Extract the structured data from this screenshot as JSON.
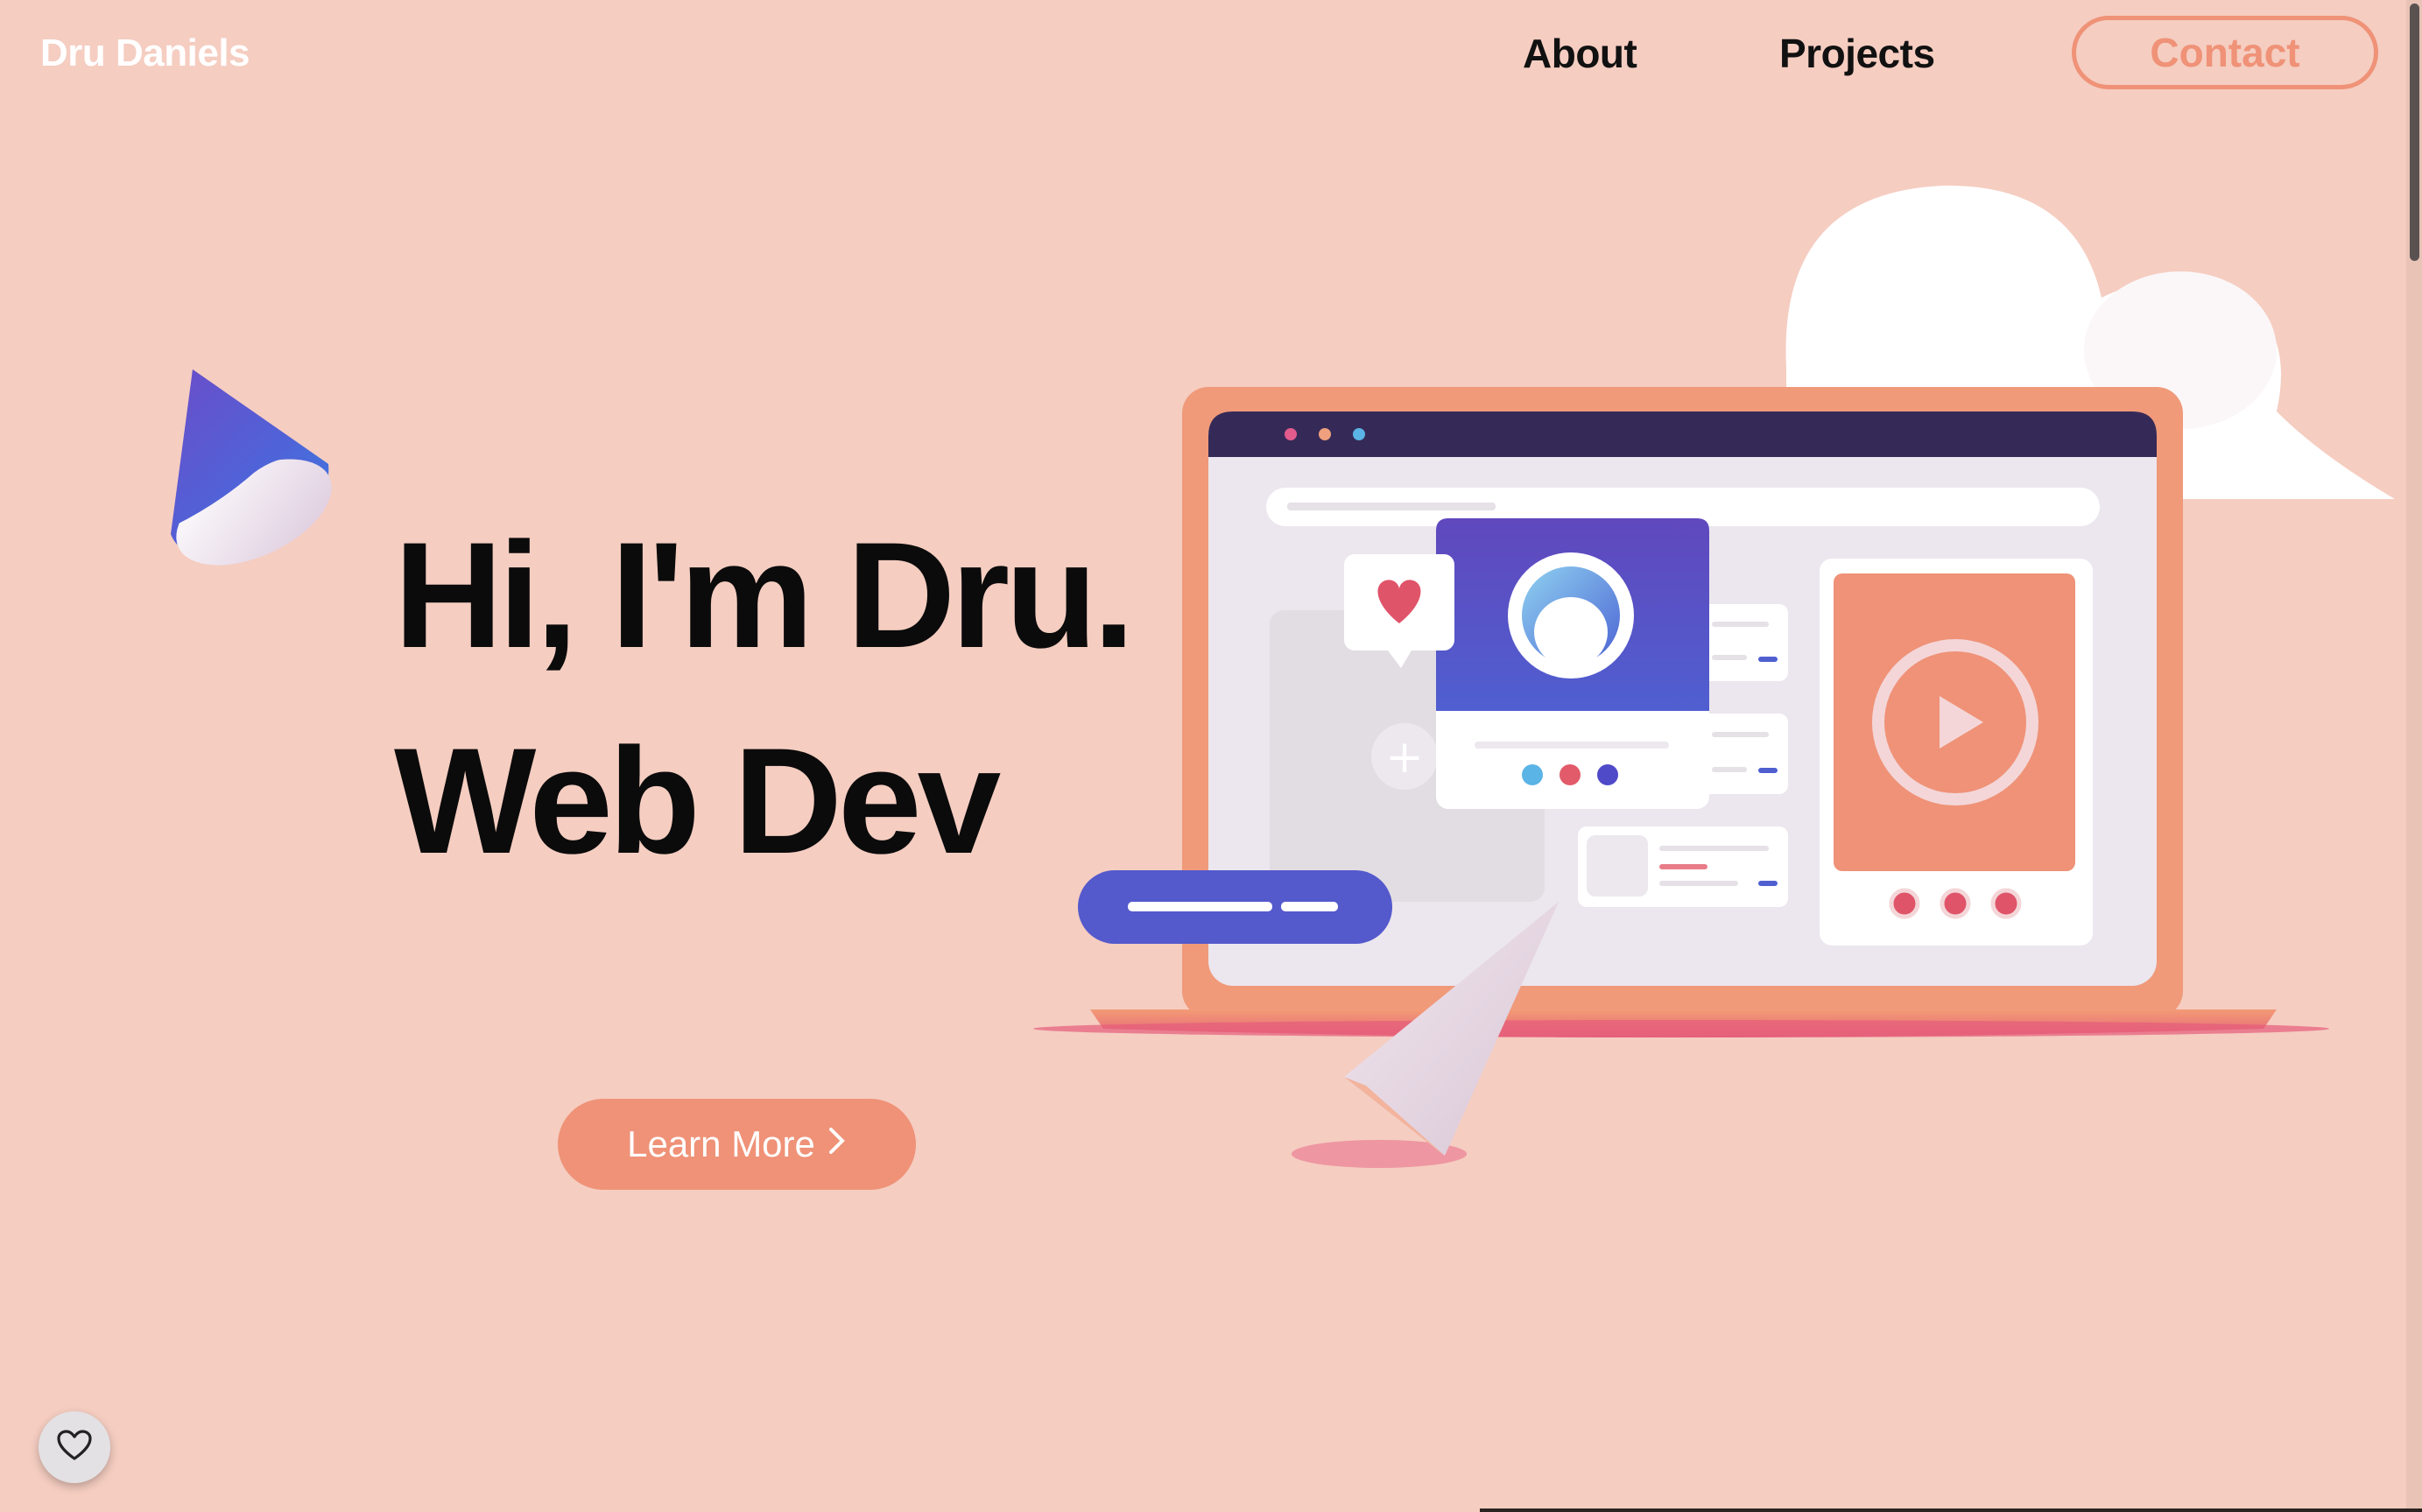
{
  "nav": {
    "brand": "Dru Daniels",
    "links": [
      {
        "label": "About"
      },
      {
        "label": "Projects"
      }
    ],
    "contact_label": "Contact"
  },
  "hero": {
    "line1": "Hi, I'm Dru.",
    "line2": "Web Dev",
    "cta_label": "Learn More",
    "cta_icon": "chevron-right-icon"
  },
  "floating": {
    "favorite_icon": "heart-outline-icon"
  },
  "colors": {
    "background": "#f5cdc1",
    "accent": "#ef9277",
    "text": "#0b0b0b",
    "brand_text": "#ffffff",
    "illustration_blue": "#5a57c8"
  }
}
